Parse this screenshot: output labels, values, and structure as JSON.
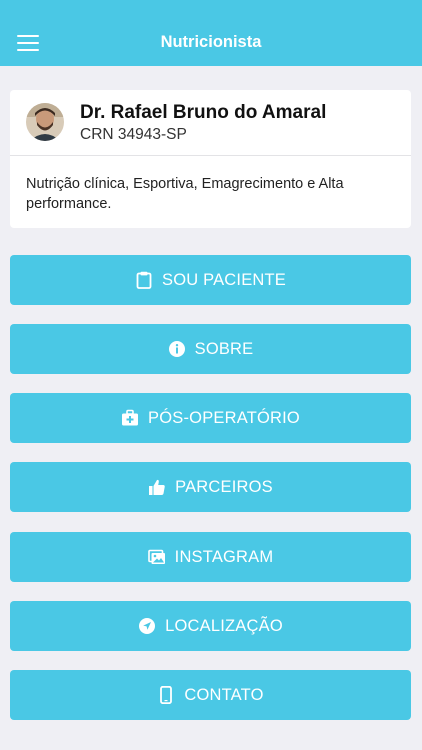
{
  "header": {
    "title": "Nutricionista",
    "menu_icon": "hamburger-menu-icon"
  },
  "profile": {
    "name": "Dr. Rafael Bruno do Amaral",
    "crn": "CRN 34943-SP",
    "description": "Nutrição clínica, Esportiva, Emagrecimento e Alta performance.",
    "avatar_icon": "person-avatar"
  },
  "menu": {
    "items": [
      {
        "label": "SOU PACIENTE",
        "icon": "clipboard-icon"
      },
      {
        "label": "SOBRE",
        "icon": "info-icon"
      },
      {
        "label": "PÓS-OPERATÓRIO",
        "icon": "medical-kit-icon"
      },
      {
        "label": "PARCEIROS",
        "icon": "thumbs-up-icon"
      },
      {
        "label": "INSTAGRAM",
        "icon": "images-icon"
      },
      {
        "label": "LOCALIZAÇÃO",
        "icon": "navigation-arrow-icon"
      },
      {
        "label": "CONTATO",
        "icon": "mobile-phone-icon"
      }
    ]
  },
  "colors": {
    "accent": "#4ac8e5",
    "background": "#efeff4",
    "card": "#ffffff"
  }
}
